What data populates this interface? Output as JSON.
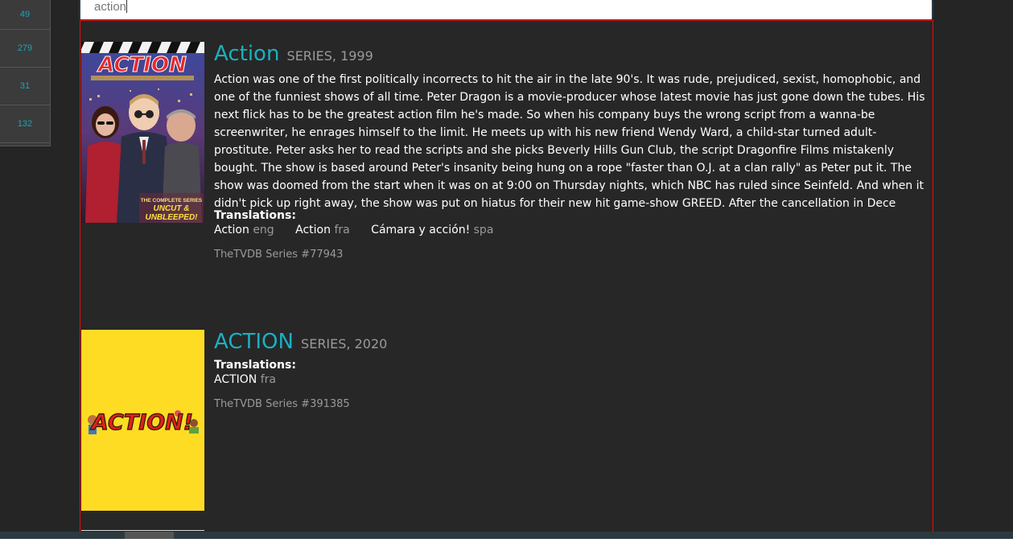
{
  "sidebar": {
    "counts": [
      "49",
      "279",
      "31",
      "132"
    ]
  },
  "search": {
    "value": "action"
  },
  "results": [
    {
      "title": "Action",
      "meta": "SERIES, 1999",
      "overview": "Action was one of the first politically incorrects to hit the air in the late 90's. It was rude, prejudiced, sexist, homophobic, and one of the funniest shows of all time. Peter Dragon is a movie-producer whose latest movie has just gone down the tubes. His next flick has to be the greatest action film he's made. So when his company buys the wrong script from a wanna-be screenwriter, he enrages himself to the limit. He meets up with his new friend Wendy Ward, a child-star turned adult-prostitute. Peter asks her to read the scripts and she picks Beverly Hills Gun Club, the script Dragonfire Films mistakenly bought. The show is based around Peter's insanity being hung on a rope \"faster than O.J. at a clan rally\" as Peter put it. The show was doomed from the start when it was on at 9:00 on Thursday nights, which NBC has ruled since Seinfeld. And when it didn't pick up right away, the show was put on hiatus for their new hit game-show GREED. After the cancellation in Dece",
      "translations_label": "Translations:",
      "translations": [
        {
          "title": "Action",
          "lang": "eng"
        },
        {
          "title": "Action",
          "lang": "fra"
        },
        {
          "title": "Cámara y acción!",
          "lang": "spa"
        }
      ],
      "source": "TheTVDB Series #77943",
      "poster": {
        "headline": "ACTION",
        "caption_1": "THE COMPLETE SERIES",
        "caption_2": "UNCUT &",
        "caption_3": "UNBLEEPED!"
      }
    },
    {
      "title": "ACTION",
      "meta": "SERIES, 2020",
      "translations_label": "Translations:",
      "translations": [
        {
          "title": "ACTION",
          "lang": "fra"
        }
      ],
      "source": "TheTVDB Series #391385",
      "poster": {
        "headline": "ACTION!"
      }
    }
  ],
  "colors": {
    "accent": "#1ab0c2",
    "highlight_border": "#e01010",
    "background": "#252525",
    "poster2_bg": "#ffdc24"
  }
}
